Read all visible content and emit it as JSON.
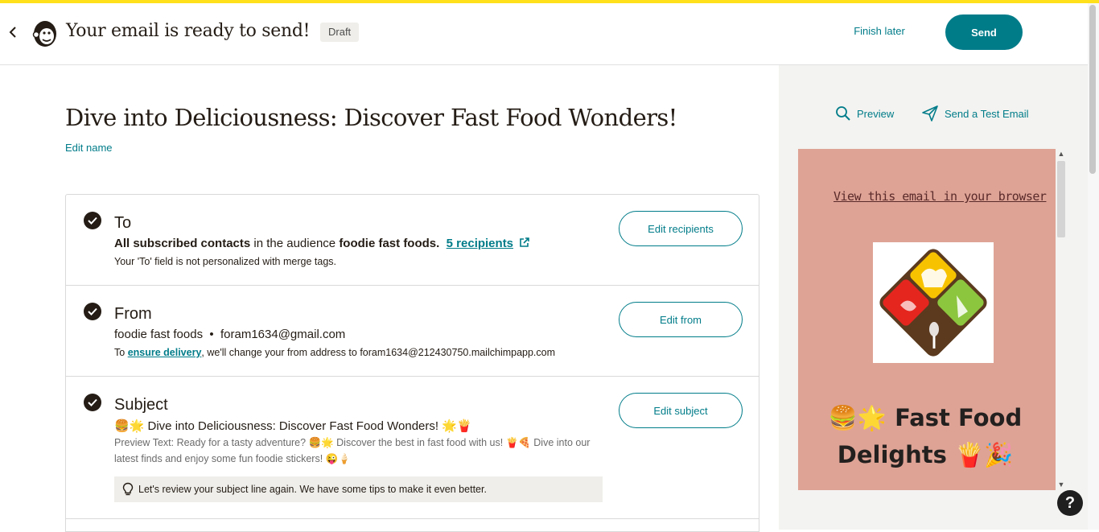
{
  "header": {
    "title": "Your email is ready to send!",
    "status_badge": "Draft",
    "finish_later_label": "Finish later",
    "send_label": "Send"
  },
  "campaign": {
    "name": "Dive into Deliciousness: Discover Fast Food Wonders!",
    "edit_name_label": "Edit name"
  },
  "to": {
    "heading": "To",
    "line_bold_1": "All subscribed contacts",
    "line_text_1": " in the audience ",
    "line_bold_2": "foodie fast foods.",
    "recipients_link": "5 recipients",
    "note": "Your 'To' field is not personalized with merge tags.",
    "edit_label": "Edit recipients"
  },
  "from": {
    "heading": "From",
    "line": "foodie fast foods  •  foram1634@gmail.com",
    "note_prefix": "To ",
    "note_link": "ensure delivery",
    "note_suffix": ", we'll change your from address to foram1634@212430750.mailchimpapp.com",
    "edit_label": "Edit from"
  },
  "subject": {
    "heading": "Subject",
    "line": "🍔🌟 Dive into Deliciousness: Discover Fast Food Wonders! 🌟🍟",
    "preview_text": "Preview Text: Ready for a tasty adventure? 🍔🌟 Discover the best in fast food with us! 🍟🍕 Dive into our latest finds and enjoy some fun foodie stickers! 😜🍦",
    "tip": "Let's review your subject line again. We have some tips to make it even better.",
    "edit_label": "Edit subject"
  },
  "side_panel": {
    "preview_label": "Preview",
    "test_email_label": "Send a Test Email",
    "view_in_browser": "View this email in your browser",
    "email_heading": "🍔🌟 Fast Food Delights 🍟🎉"
  },
  "help_label": "?",
  "colors": {
    "accent_bar": "#ffe01b",
    "primary": "#007c89",
    "preview_background": "#dea395",
    "text": "#241c15"
  },
  "icons": [
    "back-chevron-icon",
    "mailchimp-logo",
    "check-circle-icon",
    "external-link-icon",
    "search-icon",
    "paper-plane-icon",
    "lightbulb-icon",
    "help-icon"
  ]
}
